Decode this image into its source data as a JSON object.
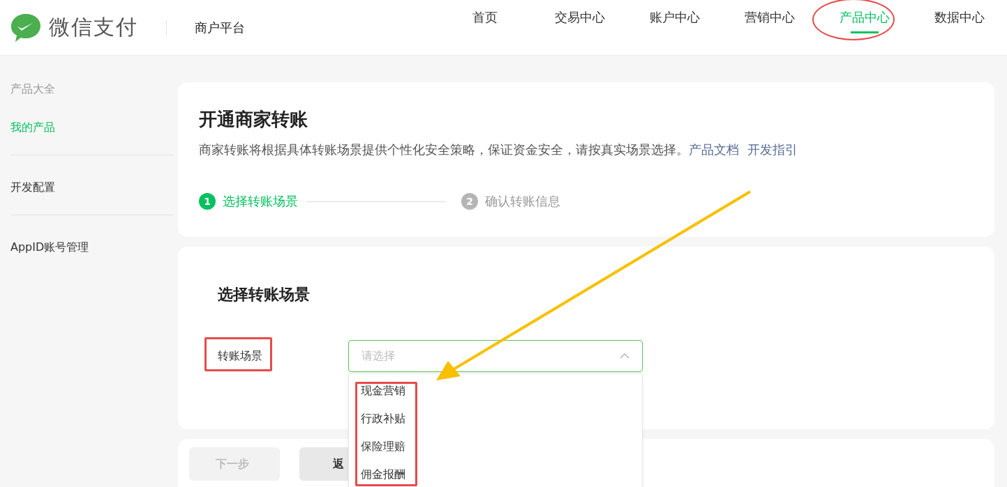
{
  "header": {
    "brand": "微信支付",
    "platform": "商户平台",
    "nav": [
      {
        "label": "首页",
        "selected": false,
        "annotated": false
      },
      {
        "label": "交易中心",
        "selected": false,
        "annotated": false
      },
      {
        "label": "账户中心",
        "selected": false,
        "annotated": false
      },
      {
        "label": "营销中心",
        "selected": false,
        "annotated": false
      },
      {
        "label": "产品中心",
        "selected": true,
        "annotated": true
      },
      {
        "label": "数据中心",
        "selected": false,
        "annotated": false
      }
    ]
  },
  "sidebar": {
    "groups": [
      {
        "items": [
          {
            "label": "产品大全",
            "kind": "heading"
          },
          {
            "label": "我的产品",
            "kind": "link",
            "selected": true
          }
        ]
      },
      {
        "items": [
          {
            "label": "开发配置",
            "kind": "link",
            "selected": false
          }
        ]
      },
      {
        "items": [
          {
            "label": "AppID账号管理",
            "kind": "link",
            "selected": false
          }
        ]
      }
    ]
  },
  "intro": {
    "title": "开通商家转账",
    "description": "商家转账将根据具体转账场景提供个性化安全策略，保证资金安全，请按真实场景选择。",
    "links": [
      "产品文档",
      "开发指引"
    ],
    "steps": [
      {
        "number": "1",
        "label": "选择转账场景",
        "selected": true
      },
      {
        "number": "2",
        "label": "确认转账信息",
        "selected": false
      }
    ]
  },
  "form": {
    "title": "选择转账场景",
    "field": {
      "label": "转账场景",
      "annotated": true,
      "placeholder": "请选择",
      "expanded": true,
      "options": [
        "现金营销",
        "行政补贴",
        "保险理赔",
        "佣金报酬"
      ],
      "options_annotated": true
    }
  },
  "footer": {
    "buttons": [
      {
        "label": "下一步",
        "disabled": true
      },
      {
        "label": "返",
        "disabled": false
      }
    ]
  }
}
